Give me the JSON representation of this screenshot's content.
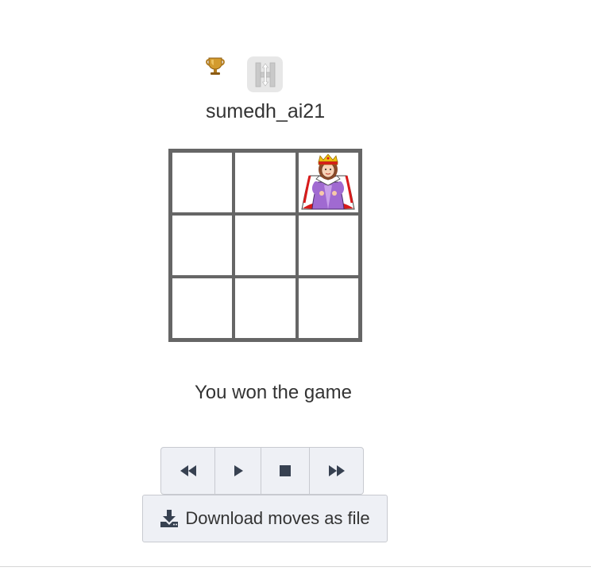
{
  "player": {
    "username": "sumedh_ai21",
    "badge_letter": "H"
  },
  "board": {
    "rows": 3,
    "cols": 3,
    "pieces": [
      {
        "row": 1,
        "col": 3,
        "piece": "queen"
      }
    ]
  },
  "status": {
    "message": "You won the game"
  },
  "controls": {
    "rewind": "rewind-icon",
    "play": "play-icon",
    "stop": "stop-icon",
    "fast_forward": "fast-forward-icon"
  },
  "download": {
    "label": "Download moves as file"
  },
  "colors": {
    "board_border": "#666666",
    "button_bg": "#eef0f5",
    "icon": "#374151"
  }
}
